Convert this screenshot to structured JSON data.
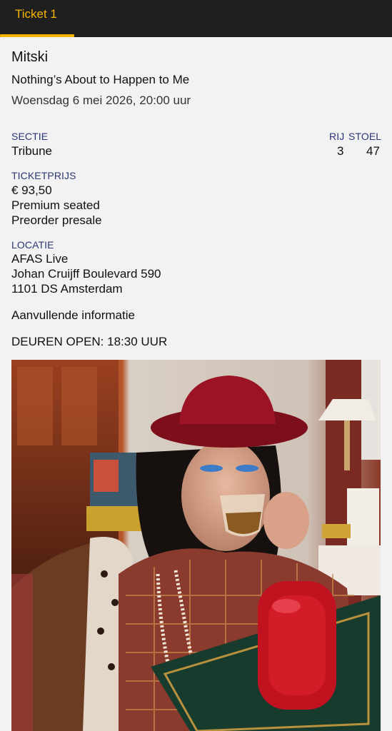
{
  "tabs": [
    {
      "label": "Ticket 1"
    }
  ],
  "event": {
    "artist": "Mitski",
    "title": "Nothing’s About to Happen to Me",
    "date": "Woensdag 6 mei 2026, 20:00 uur"
  },
  "seat": {
    "section_label": "SECTIE",
    "section_value": "Tribune",
    "row_label": "RIJ",
    "row_value": "3",
    "seat_label": "STOEL",
    "seat_value": "47"
  },
  "price": {
    "label": "TICKETPRIJS",
    "amount": "€ 93,50",
    "type": "Premium seated",
    "sale": "Preorder presale"
  },
  "location": {
    "label": "LOCATIE",
    "venue": "AFAS Live",
    "street": "Johan Cruijff Boulevard 590",
    "city": "1101 DS Amsterdam"
  },
  "extra": {
    "heading": "Aanvullende informatie",
    "doors": "DEUREN OPEN: 18:30 UUR"
  },
  "colors": {
    "accent": "#f5b400",
    "label": "#2a3675",
    "topbar": "#1f1f1f",
    "background": "#f2f2f2"
  }
}
